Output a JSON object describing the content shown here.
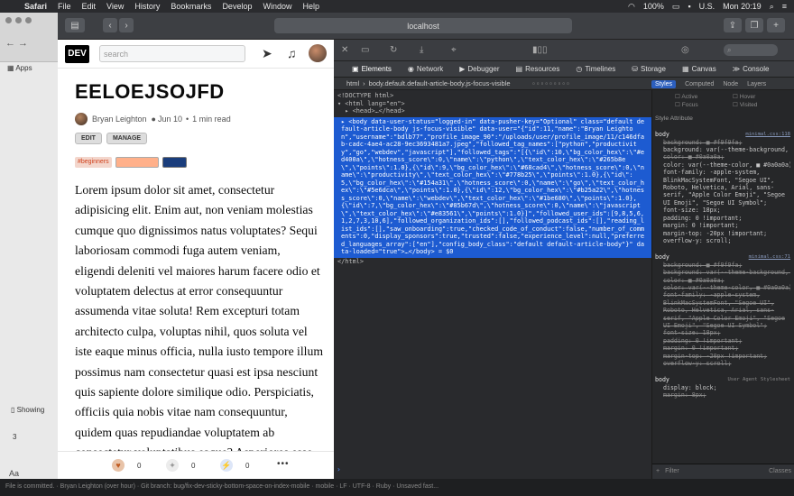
{
  "menubar": {
    "items": [
      "Safari",
      "File",
      "Edit",
      "View",
      "History",
      "Bookmarks",
      "Develop",
      "Window",
      "Help"
    ],
    "battery": "100%",
    "flag": "U.S.",
    "clock": "Mon 20:19"
  },
  "bg_window": {
    "apps_label": "Apps",
    "showing_label": "Showing",
    "partial_text": "3",
    "aa_label": "Aa"
  },
  "browser": {
    "url": "localhost"
  },
  "devnav": {
    "logo": "DEV",
    "search_placeholder": "search"
  },
  "article": {
    "title": "EELOEJSOJFD",
    "author": "Bryan Leighton",
    "date": "Jun 10",
    "read_time": "1 min read",
    "edit_label": "EDIT",
    "manage_label": "MANAGE",
    "tag_beginners": "#beginners",
    "body": "Lorem ipsum dolor sit amet, consectetur adipisicing elit. Enim aut, non veniam molestias cumque quo dignissimos natus voluptates? Sequi laboriosam commodi fuga autem veniam, eligendi deleniti vel maiores harum facere odio et voluptatem delectus at error consequuntur assumenda vitae soluta! Rem excepturi totam architecto culpa, voluptas nihil, quos soluta vel iste eaque minus officia, nulla iusto tempore illum possimus nam consectetur quasi est ipsa nesciunt quis sapiente dolore similique odio. Perspiciatis, officiis quia nobis vitae nam consequuntur, quidem quas repudiandae voluptatem ab consectetur voluptatibus eaque? Asperiores esse natus architecto ipsa. Aut alias labore fugit"
  },
  "actions": {
    "heart_count": "0",
    "unicorn_count": "0",
    "bookmark_count": "0",
    "more": "•••"
  },
  "devtools": {
    "tabs": [
      "Elements",
      "Network",
      "Debugger",
      "Resources",
      "Timelines",
      "Storage",
      "Canvas",
      "Console"
    ],
    "breadcrumb_html": "html",
    "breadcrumb_body": "body.default.default-article-body.js-focus-visible",
    "side_tabs": [
      "Styles",
      "Computed",
      "Node",
      "Layers"
    ],
    "dom_line1": "<!DOCTYPE html>",
    "dom_line2": "▾ <html lang=\"en\">",
    "dom_line3": "  ▸ <head>…</head>",
    "dom_selected": "▸ <body data-user-status=\"logged-in\" data-pusher-key=\"Optional\" class=\"default default-article-body js-focus-visible\" data-user=\"{\"id\":11,\"name\":\"Bryan Leighton\",\"username\":\"bdlb77\",\"profile_image_90\":\"/uploads/user/profile_image/11/c146dfab-cadc-4ae4-ac28-9ec3693481a7.jpeg\",\"followed_tag_names\":[\"python\",\"productivity\",\"go\",\"webdev\",\"javascript\"],\"followed_tags\":\"[{\\\"id\\\":10,\\\"bg_color_hex\\\":\\\"#ed400a\\\",\\\"hotness_score\\\":0,\\\"name\\\":\\\"python\\\",\\\"text_color_hex\\\":\\\"#265b8e\\\",\\\"points\\\":1.0},{\\\"id\\\":9,\\\"bg_color_hex\\\":\\\"#68cad4\\\",\\\"hotness_score\\\":0,\\\"name\\\":\\\"productivity\\\",\\\"text_color_hex\\\":\\\"#778b25\\\",\\\"points\\\":1.0},{\\\"id\\\":5,\\\"bg_color_hex\\\":\\\"#154a31\\\",\\\"hotness_score\\\":0,\\\"name\\\":\\\"go\\\",\\\"text_color_hex\\\":\\\"#5e6dca\\\",\\\"points\\\":1.0},{\\\"id\\\":12,\\\"bg_color_hex\\\":\\\"#b25a22\\\",\\\"hotness_score\\\":0,\\\"name\\\":\\\"webdev\\\",\\\"text_color_hex\\\":\\\"#1be680\\\",\\\"points\\\":1.0},{\\\"id\\\":7,\\\"bg_color_hex\\\":\\\"#85b67d\\\",\\\"hotness_score\\\":0,\\\"name\\\":\\\"javascript\\\",\\\"text_color_hex\\\":\\\"#e83561\\\",\\\"points\\\":1.0}]\",\"followed_user_ids\":[9,8,5,6,1,2,7,3,10,6],\"followed_organization_ids\":[],\"followed_podcast_ids\":[],\"reading_list_ids\":[],\"saw_onboarding\":true,\"checked_code_of_conduct\":false,\"number_of_comments\":0,\"display_sponsors\":true,\"trusted\":false,\"experience_level\":null,\"preferred_languages_array\":[\"en\"],\"config_body_class\":\"default default-article-body\"}\" data-loaded=\"true\">…</body> = $0",
    "dom_line_end": "</html>",
    "states": [
      "Active",
      "Hover",
      "Focus",
      "Visited"
    ],
    "style_attribute_label": "Style Attribute",
    "rule1_selector": "body",
    "rule1_source": "minimal.css:118",
    "rule1_props": [
      "background: ■ #f9f9fa;",
      "background: var(--theme-background, ■ #f9f9fa);",
      "color: ■ #0a0a0a;",
      "color: var(--theme-color, ■ #0a0a0a);",
      "font-family: -apple-system, BlinkMacSystemFont, \"Segoe UI\", Roboto, Helvetica, Arial, sans-serif, \"Apple Color Emoji\", \"Segoe UI Emoji\", \"Segoe UI Symbol\";",
      "font-size: 18px;",
      "padding: 0 !important;",
      "margin: 0 !important;",
      "margin-top: -20px !important;",
      "overflow-y: scroll;"
    ],
    "rule2_selector": "body",
    "rule2_source": "minimal.css:71",
    "rule2_props": [
      "background: ■ #f9f9fa;",
      "background: var(--theme-background, ■ #f9f9fa);",
      "color: ■ #0a0a0a;",
      "color: var(--theme-color, ■ #0a0a0a);",
      "font-family: -apple-system, BlinkMacSystemFont, \"Segoe UI\", Roboto, Helvetica, Arial, sans-serif, \"Apple Color Emoji\", \"Segoe UI Emoji\", \"Segoe UI Symbol\";",
      "font-size: 18px;",
      "padding: 0 !important;",
      "margin: 0 !important;",
      "margin-top: -20px !important;",
      "overflow-y: scroll;"
    ],
    "rule3_selector": "body",
    "rule3_source": "User Agent Stylesheet",
    "rule3_props": [
      "display: block;",
      "margin: 8px;"
    ],
    "filter_placeholder": "Filter",
    "classes_label": "Classes"
  },
  "statusbar": {
    "text": "File is committed.  ·  Bryan Leighton (over hour)  ·  Git branch: bug/fix-dev-sticky-bottom-space-on-index-mobile  ·  mobile  ·  LF  ·  UTF-8  ·  Ruby  ·  Unsaved fast..."
  }
}
